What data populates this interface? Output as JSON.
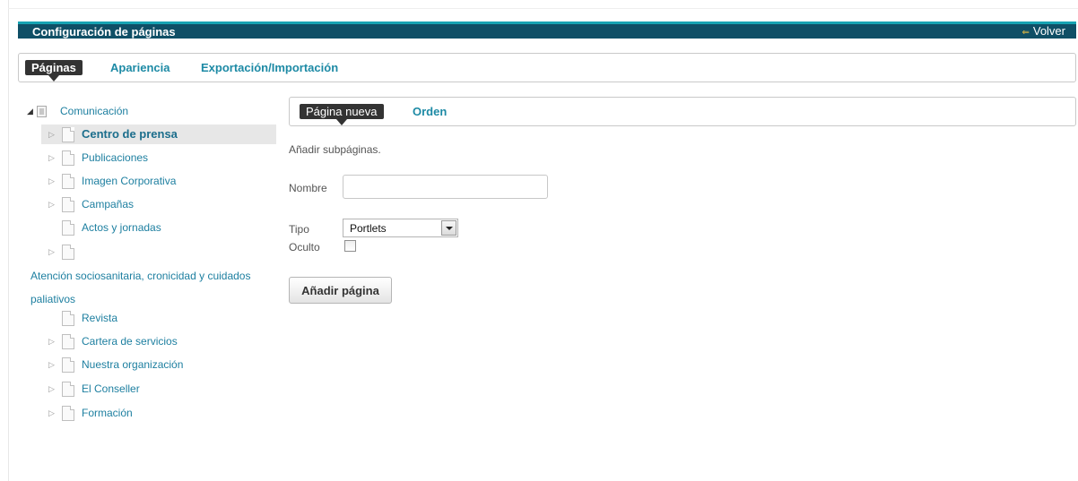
{
  "header": {
    "title": "Configuración de páginas",
    "back_label": "Volver"
  },
  "main_tabs": [
    {
      "label": "Páginas",
      "active": true
    },
    {
      "label": "Apariencia",
      "active": false
    },
    {
      "label": "Exportación/Importación",
      "active": false
    }
  ],
  "tree": {
    "root": "Comunicación",
    "items": [
      {
        "label": "Centro de prensa",
        "selected": true,
        "expandable": true
      },
      {
        "label": "Publicaciones",
        "expandable": true
      },
      {
        "label": "Imagen Corporativa",
        "expandable": true
      },
      {
        "label": "Campañas",
        "expandable": true
      },
      {
        "label": "Actos y jornadas",
        "expandable": false
      },
      {
        "label": "Atención sociosanitaria, cronicidad y cuidados paliativos",
        "expandable": true
      },
      {
        "label": "Revista",
        "expandable": false
      },
      {
        "label": "Cartera de servicios",
        "expandable": true
      },
      {
        "label": "Nuestra organización",
        "expandable": true
      },
      {
        "label": "El Conseller",
        "expandable": true
      },
      {
        "label": "Formación",
        "expandable": true
      }
    ]
  },
  "sub_tabs": [
    {
      "label": "Página nueva",
      "active": true
    },
    {
      "label": "Orden",
      "active": false
    }
  ],
  "form": {
    "intro": "Añadir subpáginas.",
    "name_label": "Nombre",
    "name_value": "",
    "type_label": "Tipo",
    "type_value": "Portlets",
    "hidden_label": "Oculto",
    "hidden_checked": false,
    "submit_label": "Añadir página"
  },
  "colors": {
    "header_bg": "#0f4f66",
    "header_accent": "#17a3b3",
    "link": "#1d8aa5",
    "active_tab": "#333333"
  }
}
